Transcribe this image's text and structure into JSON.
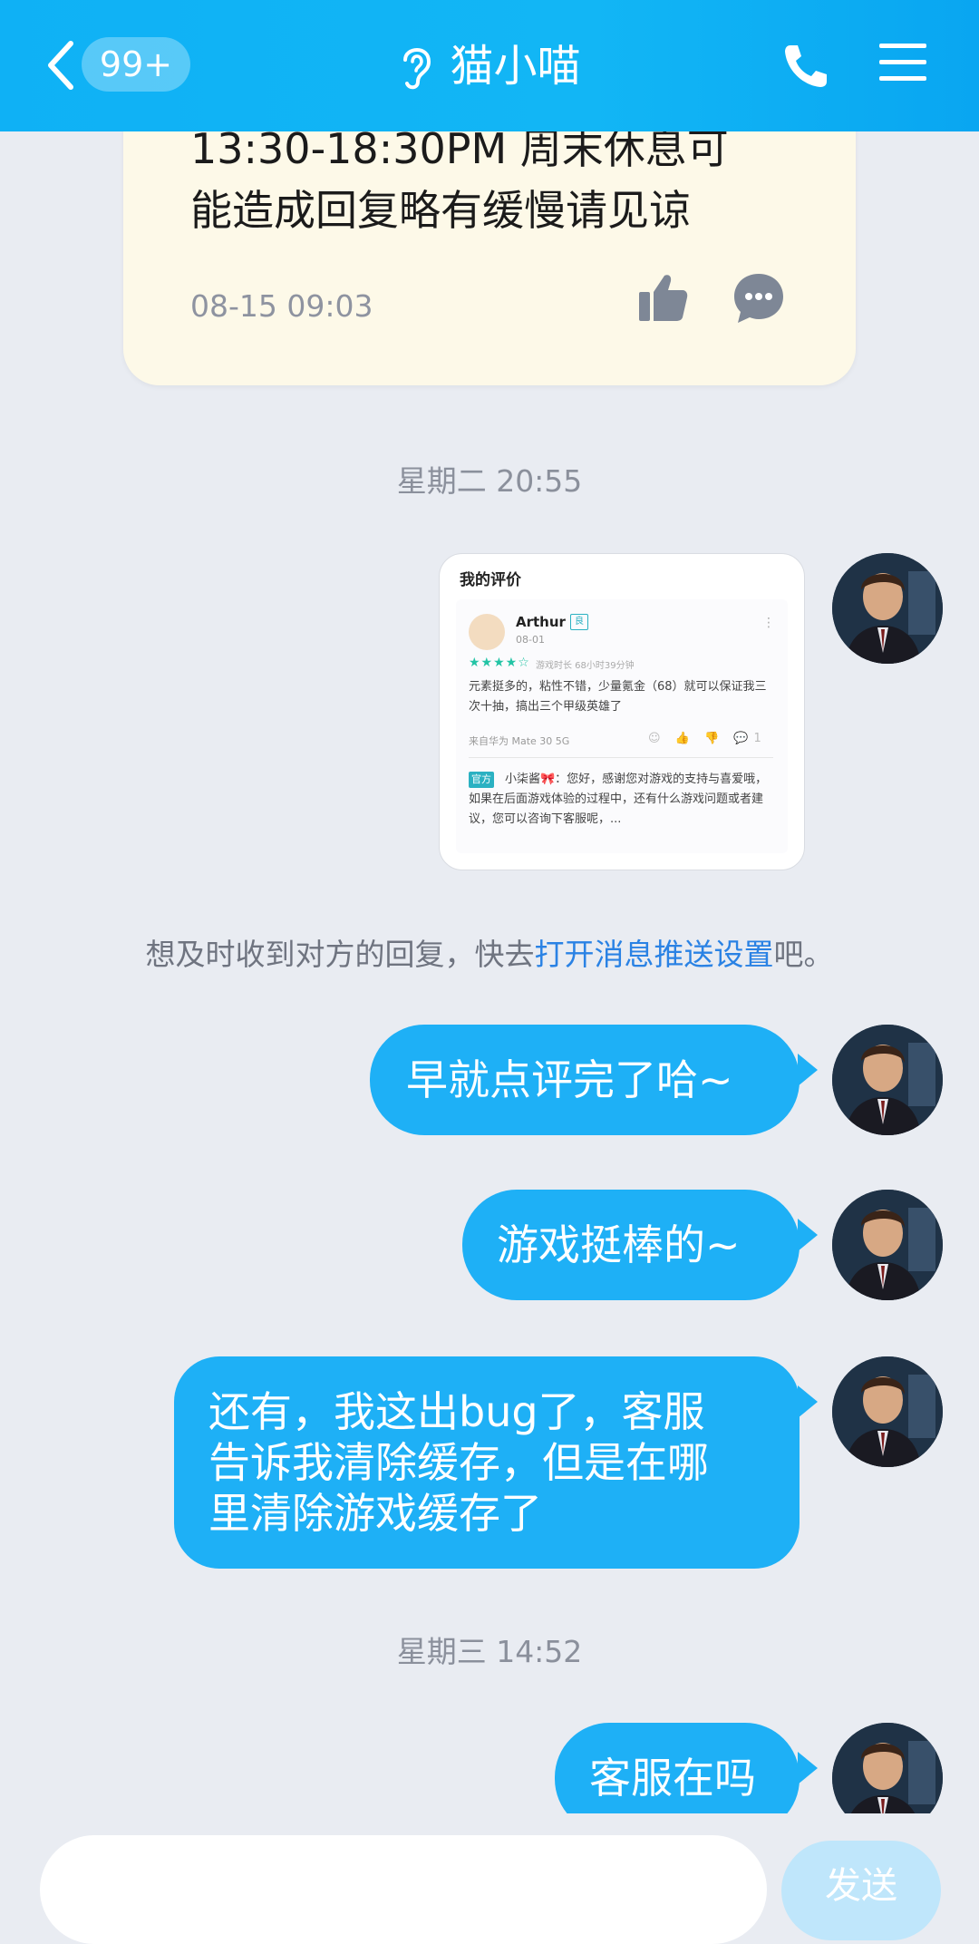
{
  "header": {
    "back_label": "返回",
    "unread_count": "99+",
    "title": "猫小喵",
    "icons": [
      "chevron-left-icon",
      "ear-icon",
      "phone-icon",
      "menu-icon"
    ],
    "bg_color": "#12b6f5"
  },
  "pinned_card": {
    "text_line_1": "13:30-18:30PM 周末休息可",
    "text_line_2": "能造成回复略有缓慢请见谅",
    "time": "08-15 09:03",
    "icons": [
      "thumb-up-icon",
      "comment-icon"
    ]
  },
  "timestamps": {
    "first": "星期二 20:55",
    "second": "星期三 14:52"
  },
  "screenshot_message": {
    "title": "我的评价",
    "user": "Arthur",
    "tag": "良",
    "date": "08-01",
    "rating_stars": 4,
    "stars_text": "★★★★☆",
    "playtime": "游戏时长 68小时39分钟",
    "review": "元素挺多的，粘性不错，少量氪金（68）就可以保证我三次十抽，搞出三个甲级英雄了",
    "device": "来自华为 Mate 30 5G",
    "actions_text": "☺ 👍 👎 💬1",
    "official_tag": "官方",
    "reply": "小柒酱🎀：您好，感谢您对游戏的支持与喜爱哦，如果在后面游戏体验的过程中，还有什么游戏问题或者建议，您可以咨询下客服呢，..."
  },
  "notice": {
    "prefix": "想及时收到对方的回复，快去",
    "link": "打开消息推送设置",
    "suffix": "吧。"
  },
  "messages": [
    {
      "lines": [
        "早就点评完了哈~"
      ]
    },
    {
      "lines": [
        "游戏挺棒的~"
      ]
    },
    {
      "lines": [
        "还有，我这出bug了，客服",
        "告诉我清除缓存，但是在哪",
        "里清除游戏缓存了"
      ]
    },
    {
      "lines": [
        "客服在吗"
      ]
    }
  ],
  "input": {
    "value": "",
    "send_label": "发送"
  },
  "colors": {
    "bubble": "#1eb0f6",
    "background": "#e9ecf2",
    "card": "#fdf9e8",
    "link": "#2a82e4"
  }
}
